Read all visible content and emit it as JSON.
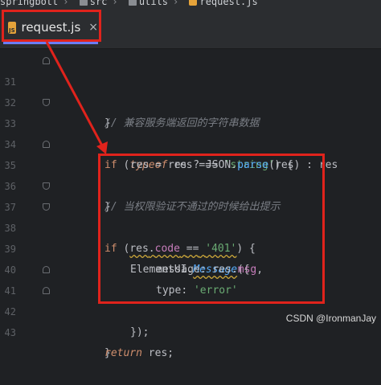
{
  "breadcrumbs": {
    "project": "springbott",
    "path": [
      "src",
      "utils"
    ],
    "file": "request.js"
  },
  "tab": {
    "badge": "JS",
    "label": "request.js",
    "close": "×"
  },
  "colors": {
    "annotation": "#e0231c",
    "tab_underline": "#6b7df5",
    "js_badge": "#e5a33a"
  },
  "code": {
    "lines": [
      {
        "no": "31",
        "text": "}"
      },
      {
        "no": "32",
        "text": "// 兼容服务端返回的字符串数据"
      },
      {
        "no": "33",
        "text": "if (typeof res === 'string') {"
      },
      {
        "no": "34",
        "text": "res = res ? JSON.parse(res) : res"
      },
      {
        "no": "35",
        "text": "}"
      },
      {
        "no": "36",
        "text": "// 当权限验证不通过的时候给出提示"
      },
      {
        "no": "37",
        "text": "if (res.code == '401') {"
      },
      {
        "no": "38",
        "text": "ElementUI.Message({"
      },
      {
        "no": "39",
        "text": "message: res.msg,"
      },
      {
        "no": "40",
        "text": "type: 'error'"
      },
      {
        "no": "41",
        "text": "});"
      },
      {
        "no": "42",
        "text": "}"
      },
      {
        "no": "43",
        "text": "return res;"
      }
    ],
    "tokens": {
      "if_kw": "if",
      "typeof_kw": "typeof",
      "res": "res",
      "strict_eq": "===",
      "string_lit": "'string'",
      "json": "JSON",
      "parse": "parse",
      "code_prop": "code",
      "loose_eq": "==",
      "code_401": "'401'",
      "element_ui": "ElementUI",
      "message_fn": "Message",
      "message_key": "message",
      "msg_prop": "msg",
      "type_key": "type",
      "error_lit": "'error'",
      "return_kw": "return"
    }
  },
  "watermark": "CSDN @IronmanJay"
}
